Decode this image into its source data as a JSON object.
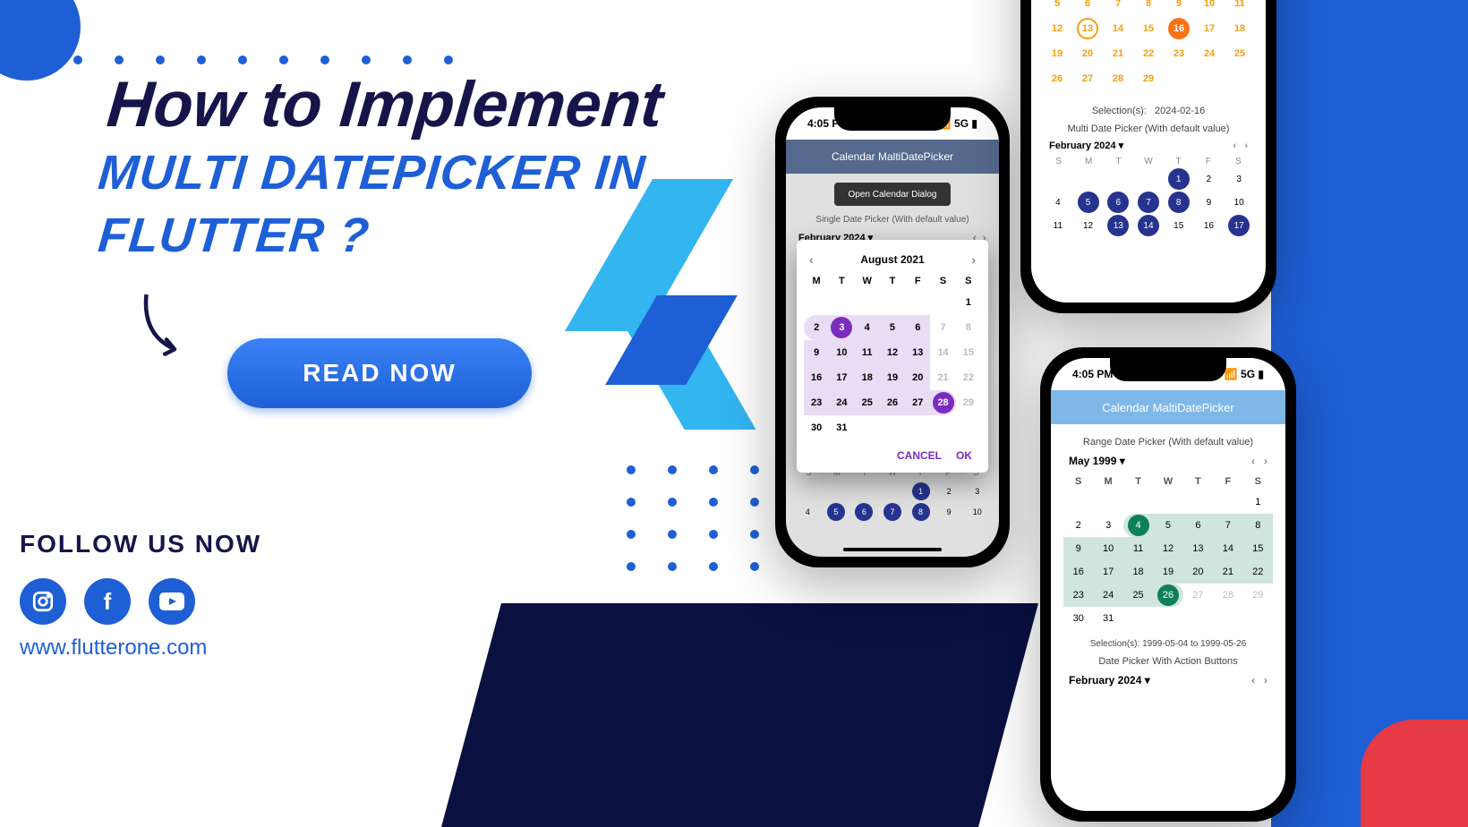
{
  "title": {
    "line1": "How to Implement",
    "line2": "MULTI DATEPICKER IN",
    "line3": "FLUTTER ?"
  },
  "cta": "READ NOW",
  "follow": "FOLLOW US NOW",
  "url": "www.flutterone.com",
  "status": {
    "time": "4:05 PM",
    "net": "5G"
  },
  "phone1": {
    "appbar": "Calendar MaltiDatePicker",
    "open": "Open Calendar Dialog",
    "single": "Single Date Picker (With default value)",
    "month": "February 2024",
    "dialog": {
      "month": "August 2021",
      "wk": [
        "M",
        "T",
        "W",
        "T",
        "F",
        "S",
        "S"
      ],
      "cancel": "CANCEL",
      "ok": "OK"
    },
    "bottom_wk": [
      "S",
      "M",
      "T",
      "W",
      "T",
      "F",
      "S"
    ]
  },
  "phone2": {
    "sel_label": "Selection(s):",
    "sel_val": "2024-02-16",
    "multi": "Multi Date Picker (With default value)",
    "month": "February 2024",
    "wk": [
      "S",
      "M",
      "T",
      "W",
      "T",
      "F",
      "S"
    ]
  },
  "phone3": {
    "appbar": "Calendar MaltiDatePicker",
    "range": "Range Date Picker (With default value)",
    "month": "May 1999",
    "wk": [
      "S",
      "M",
      "T",
      "W",
      "T",
      "F",
      "S"
    ],
    "sel": "Selection(s):    1999-05-04  to 1999-05-26",
    "action": "Date Picker With Action Buttons",
    "month2": "February 2024"
  }
}
